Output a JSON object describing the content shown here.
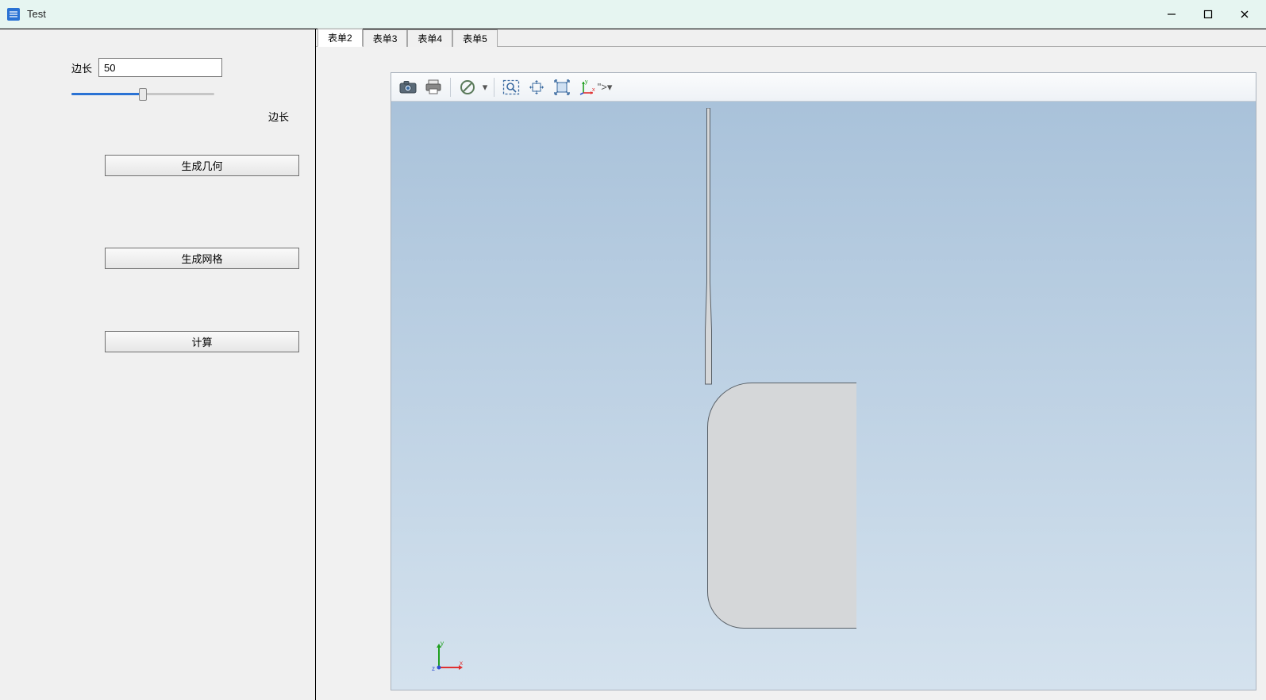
{
  "window": {
    "title": "Test"
  },
  "sidebar": {
    "field_label_left": "边长",
    "field_value": "50",
    "field_label_right": "边长",
    "slider_percent": 50,
    "buttons": {
      "generate_geometry": "生成几何",
      "generate_mesh": "生成网格",
      "compute": "计算"
    }
  },
  "tabs": [
    {
      "id": "form2",
      "label": "表单2",
      "active": true
    },
    {
      "id": "form3",
      "label": "表单3",
      "active": false
    },
    {
      "id": "form4",
      "label": "表单4",
      "active": false
    },
    {
      "id": "form5",
      "label": "表单5",
      "active": false
    }
  ],
  "toolbar_icons": [
    "snapshot-icon",
    "print-icon",
    "separator",
    "no-entry-icon",
    "dropdown-arrow",
    "separator",
    "zoom-area-icon",
    "pan-icon",
    "zoom-extents-icon",
    "axis-orientation-icon",
    "dropdown-arrow"
  ],
  "triad": {
    "x_label": "x",
    "y_label": "y",
    "z_label": "z",
    "x_color": "#e03030",
    "y_color": "#20a020",
    "z_color": "#3050d0"
  }
}
